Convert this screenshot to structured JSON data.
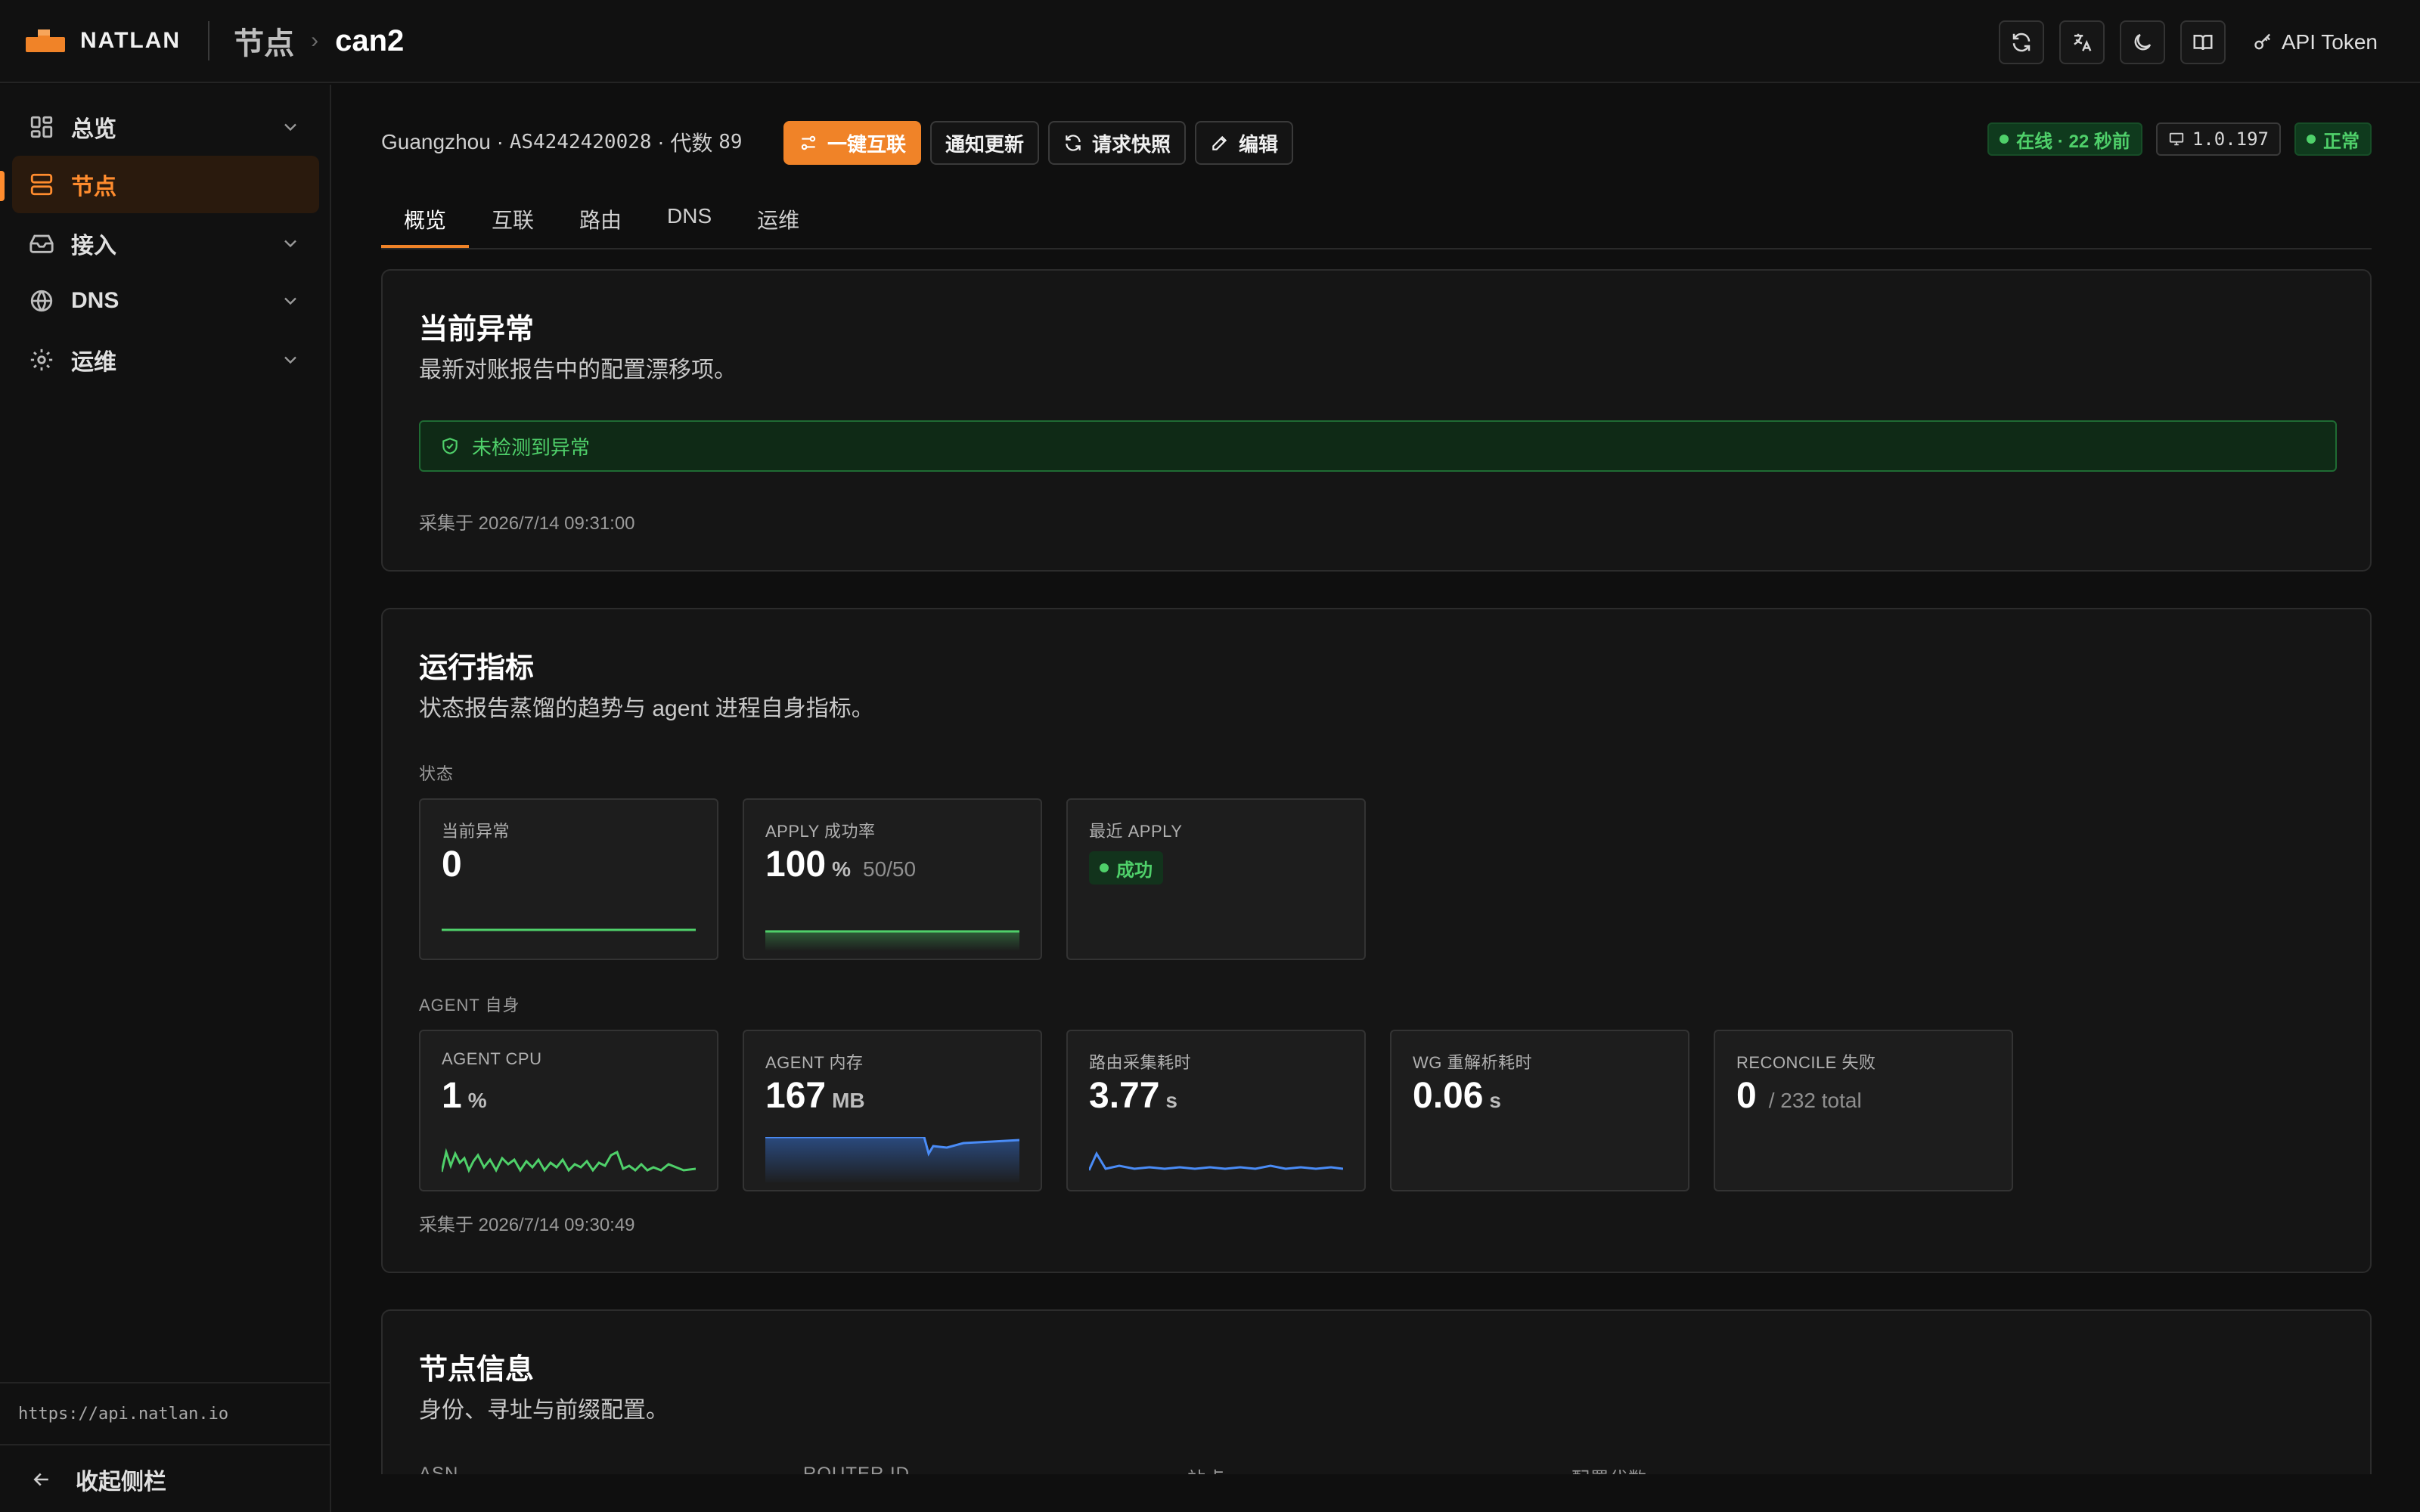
{
  "app": {
    "brand": "NATLAN",
    "breadcrumb": [
      "节点",
      "can2"
    ],
    "token_label": "API Token",
    "icon_names": [
      "refresh-icon",
      "translate-icon",
      "moon-icon",
      "book-icon",
      "key-icon"
    ]
  },
  "sidebar": {
    "items": [
      {
        "label": "总览",
        "icon": "dashboard-icon",
        "expandable": true
      },
      {
        "label": "节点",
        "icon": "server-icon",
        "active": true
      },
      {
        "label": "接入",
        "icon": "inbox-icon",
        "expandable": true
      },
      {
        "label": "DNS",
        "icon": "globe-icon",
        "expandable": true
      },
      {
        "label": "运维",
        "icon": "gear-icon",
        "expandable": true
      }
    ],
    "api_url": "https://api.natlan.io",
    "collapse_label": "收起侧栏"
  },
  "node": {
    "location": "Guangzhou",
    "asn": "AS4242420028",
    "gen_label": "代数",
    "gen_value": "89",
    "buttons": {
      "interconnect": "一键互联",
      "notify_update": "通知更新",
      "request_snapshot": "请求快照",
      "edit": "编辑"
    },
    "status": {
      "online": "在线 · 22 秒前",
      "version": "1.0.197",
      "health": "正常"
    }
  },
  "tabs": [
    "概览",
    "互联",
    "路由",
    "DNS",
    "运维"
  ],
  "anomaly_card": {
    "title": "当前异常",
    "subtitle": "最新对账报告中的配置漂移项。",
    "banner": "未检测到异常",
    "collected": "采集于 2026/7/14 09:31:00"
  },
  "metrics_card": {
    "title": "运行指标",
    "subtitle": "状态报告蒸馏的趋势与 agent 进程自身指标。",
    "status_section": "状态",
    "agent_section": "AGENT 自身",
    "status_metrics": [
      {
        "label": "当前异常",
        "value": "0",
        "unit": "",
        "extra": ""
      },
      {
        "label": "APPLY 成功率",
        "value": "100",
        "unit": "%",
        "extra": "50/50"
      },
      {
        "label": "最近 APPLY",
        "badge": "成功"
      }
    ],
    "agent_metrics": [
      {
        "label": "AGENT CPU",
        "value": "1",
        "unit": "%",
        "extra": ""
      },
      {
        "label": "AGENT 内存",
        "value": "167",
        "unit": "MB",
        "extra": ""
      },
      {
        "label": "路由采集耗时",
        "value": "3.77",
        "unit": "s",
        "extra": ""
      },
      {
        "label": "WG 重解析耗时",
        "value": "0.06",
        "unit": "s",
        "extra": ""
      },
      {
        "label": "RECONCILE 失败",
        "value": "0",
        "unit": "",
        "extra": "/ 232 total"
      }
    ],
    "collected": "采集于 2026/7/14 09:30:49"
  },
  "info_card": {
    "title": "节点信息",
    "subtitle": "身份、寻址与前缀配置。",
    "columns": [
      "ASN",
      "ROUTER ID",
      "站点",
      "配置代数"
    ]
  },
  "colors": {
    "accent": "#f08328",
    "ok_green": "#4fd06a",
    "chart_blue": "#3b82f6"
  }
}
